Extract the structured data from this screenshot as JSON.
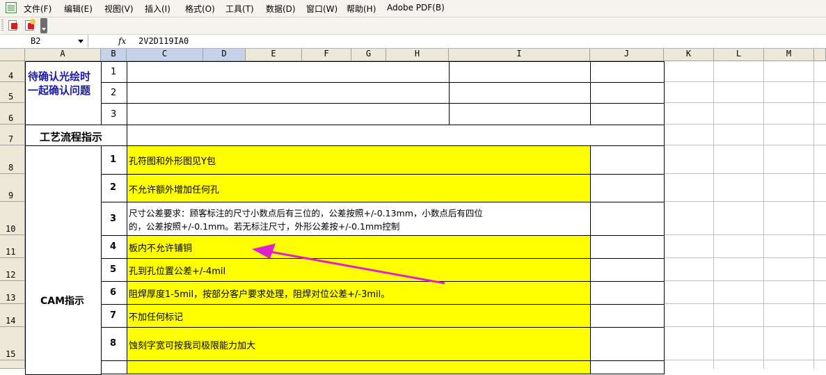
{
  "menu": {
    "items": [
      "文件(F)",
      "编辑(E)",
      "视图(V)",
      "插入(I)",
      "格式(O)",
      "工具(T)",
      "数据(D)",
      "窗口(W)",
      "帮助(H)",
      "Adobe PDF(B)"
    ]
  },
  "formula_bar": {
    "name_box": "B2",
    "fx": "fx",
    "value": "2V2D119IA0"
  },
  "columns": [
    "A",
    "B",
    "C",
    "D",
    "E",
    "F",
    "G",
    "H",
    "I",
    "J",
    "K",
    "L",
    "M"
  ],
  "rows": [
    "4",
    "5",
    "6",
    "7",
    "8",
    "9",
    "10",
    "11",
    "12",
    "13",
    "14",
    "15"
  ],
  "sheet": {
    "pending_label_line1": "待确认光绘时",
    "pending_label_line2": "一起确认问题",
    "pending_nums": [
      "1",
      "2",
      "3"
    ],
    "process_label": "工艺流程指示",
    "cam_label": "CAM指示",
    "cam_items": [
      {
        "num": "1",
        "text": "孔符图和外形图见Y包"
      },
      {
        "num": "2",
        "text": "不允许额外增加任何孔"
      },
      {
        "num": "3",
        "text": "尺寸公差要求：顾客标注的尺寸小数点后有三位的，公差按照+/-0.13mm，小数点后有四位",
        "text2": "的，公差按照+/-0.1mm。若无标注尺寸，外形公差按+/-0.1mm控制"
      },
      {
        "num": "4",
        "text": "板内不允许铺铜"
      },
      {
        "num": "5",
        "text": "孔到孔位置公差+/-4mil"
      },
      {
        "num": "6",
        "text": "阻焊厚度1-5mil，按部分客户要求处理，阻焊对位公差+/-3mil。"
      },
      {
        "num": "7",
        "text": "不加任何标记"
      },
      {
        "num": "8",
        "text": "蚀刻字宽可按我司极限能力加大"
      }
    ]
  },
  "colors": {
    "highlight": "#ffff00",
    "arrow": "#e020d0",
    "header_bg": "#ece9d8",
    "selected_header": "#c4d3ea"
  }
}
